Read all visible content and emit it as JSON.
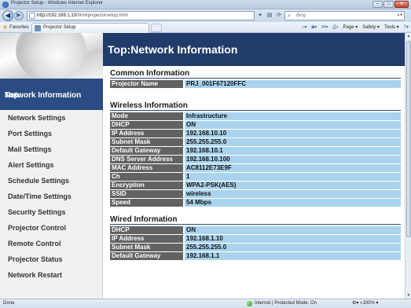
{
  "browser": {
    "window_title": "Projector Setup - Windows Internet Explorer",
    "url_host": "http://192.168.1.10",
    "url_path": "/html/projectorsetup.html",
    "search_placeholder": "Bing",
    "favorites_label": "Favorites",
    "tab_label": "Projector Setup",
    "cmd": {
      "page": "Page ▾",
      "safety": "Safety ▾",
      "tools": "Tools ▾"
    },
    "status_done": "Done",
    "status_zone": "Internet | Protected Mode: On",
    "zoom": "100%"
  },
  "sidebar": {
    "active": {
      "line1": "Top:",
      "line2": "Network Information"
    },
    "items": [
      "Network Settings",
      "Port Settings",
      "Mail Settings",
      "Alert Settings",
      "Schedule Settings",
      "Date/Time Settings",
      "Security Settings",
      "Projector Control",
      "Remote Control",
      "Projector Status",
      "Network Restart"
    ]
  },
  "page": {
    "title": "Top:Network Information",
    "common": {
      "title": "Common Information",
      "rows": [
        {
          "label": "Projector Name",
          "value": "PRJ_001F67120FFC"
        }
      ]
    },
    "wireless": {
      "title": "Wireless Information",
      "rows": [
        {
          "label": "Mode",
          "value": "Infrastructure"
        },
        {
          "label": "DHCP",
          "value": "ON"
        },
        {
          "label": "IP Address",
          "value": "192.168.10.10"
        },
        {
          "label": "Subnet Mask",
          "value": "255.255.255.0"
        },
        {
          "label": "Default Gateway",
          "value": "192.168.10.1"
        },
        {
          "label": "DNS Server Address",
          "value": "192.168.10.100"
        },
        {
          "label": "MAC Address",
          "value": "AC8112E73E9F"
        },
        {
          "label": "Ch",
          "value": "1"
        },
        {
          "label": "Encryption",
          "value": "WPA2-PSK(AES)"
        },
        {
          "label": "SSID",
          "value": "wireless"
        },
        {
          "label": "Speed",
          "value": "54 Mbps"
        }
      ]
    },
    "wired": {
      "title": "Wired Information",
      "rows": [
        {
          "label": "DHCP",
          "value": "ON"
        },
        {
          "label": "IP Address",
          "value": "192.168.1.10"
        },
        {
          "label": "Subnet Mask",
          "value": "255.255.255.0"
        },
        {
          "label": "Default Gateway",
          "value": "192.168.1.1"
        }
      ]
    }
  }
}
